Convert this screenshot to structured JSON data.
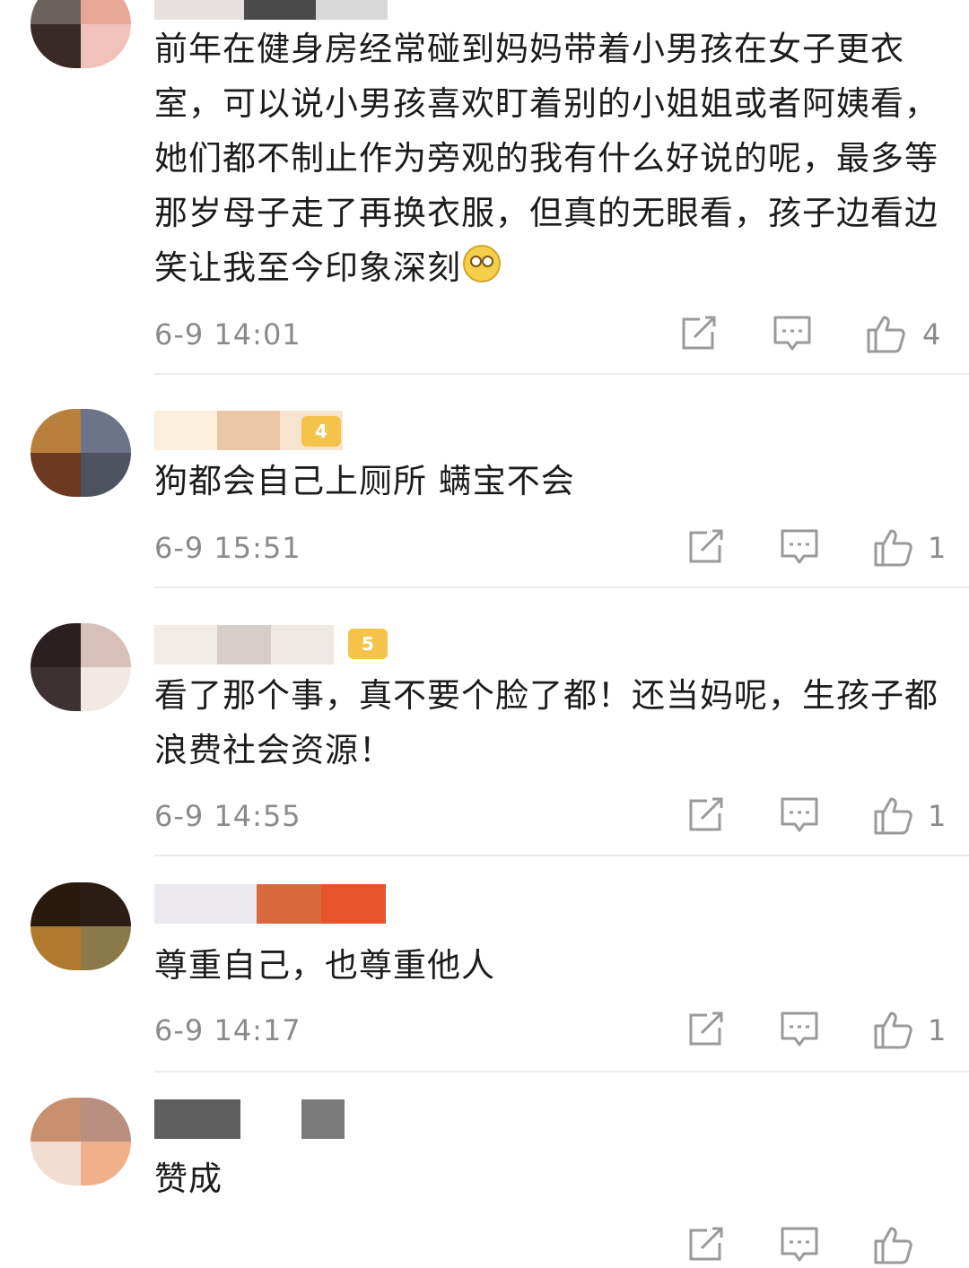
{
  "comments": [
    {
      "text": "前年在健身房经常碰到妈妈带着小男孩在女子更衣室，可以说小男孩喜欢盯着别的小姐姐或者阿姨看，她们都不制止作为旁观的我有什么好说的呢，最多等那岁母子走了再换衣服，但真的无眼看，孩子边看边笑让我至今印象深刻",
      "emoji": "sweat-smile-emoji",
      "time": "6-9 14:01",
      "likes": "4",
      "avatar_colors": [
        "#6b625f",
        "#e8a898",
        "#3a2a26",
        "#f0c2b9"
      ],
      "name_colors": [
        "#e6e1de",
        "#4a4a4a",
        "#d8d8d8"
      ]
    },
    {
      "text": "狗都会自己上厕所 螨宝不会",
      "time": "6-9 15:51",
      "likes": "1",
      "avatar_colors": [
        "#b8803c",
        "#6c7487",
        "#6e3a22",
        "#4d5360"
      ],
      "name_colors": [
        "#fbeedb",
        "#ecc7a6",
        "#f7e4cf"
      ],
      "badge": "4"
    },
    {
      "text": "看了那个事，真不要个脸了都！还当妈呢，生孩子都浪费社会资源！",
      "time": "6-9 14:55",
      "likes": "1",
      "avatar_colors": [
        "#2c1f22",
        "#d8bfb8",
        "#3e3134",
        "#f2e8e4"
      ],
      "name_colors": [
        "#f1ece6",
        "#d7cfc7",
        "#efe9e3"
      ],
      "badge": "5"
    },
    {
      "text": "尊重自己，也尊重他人",
      "time": "6-9 14:17",
      "likes": "1",
      "avatar_colors": [
        "#2a1a0e",
        "#2b1d14",
        "#b07a2e",
        "#8a7a4a"
      ],
      "name_colors": [
        "#ece9ee",
        "#d9683b",
        "#e5542a"
      ]
    },
    {
      "text": "赞成",
      "time": "",
      "likes": "",
      "avatar_colors": [
        "#c9906e",
        "#b99080",
        "#f1ddd2",
        "#f0b08a"
      ],
      "name_colors": [
        "#5e5e5e",
        "#ffffff",
        "#7a7a7a"
      ]
    }
  ],
  "actions": {
    "share_icon": "share-icon",
    "reply_icon": "comment-icon",
    "like_icon": "thumbs-up-icon"
  },
  "colors": {
    "text": "#1c1c1c",
    "meta": "#8a8a8a",
    "divider": "#ececec",
    "badge": "#f3c34a"
  }
}
